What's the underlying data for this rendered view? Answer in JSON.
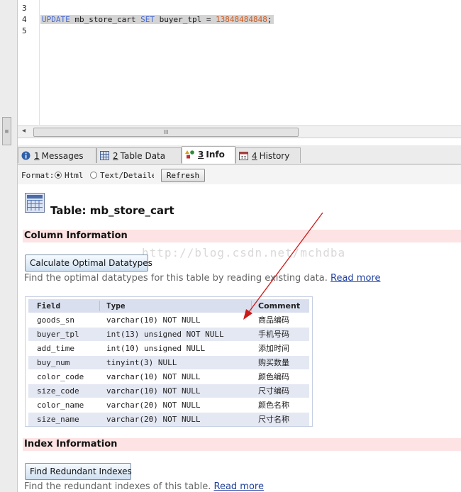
{
  "editor": {
    "line_numbers": [
      "3",
      "4",
      "5"
    ],
    "update_kw": "UPDATE",
    "update_table": " mb_store_cart ",
    "set_kw": "SET",
    "set_expr": " buyer_tpl = ",
    "set_value": "13848484848",
    "terminator": ";",
    "scroll_thumb_grip": "III"
  },
  "tabs": [
    {
      "num": "1",
      "label": "Messages",
      "icon": "info-circle-icon"
    },
    {
      "num": "2",
      "label": "Table Data",
      "icon": "grid-icon"
    },
    {
      "num": "3",
      "label": "Info",
      "icon": "shapes-icon"
    },
    {
      "num": "4",
      "label": "History",
      "icon": "calendar-icon"
    }
  ],
  "active_tab_index": 2,
  "format": {
    "label": "Format:",
    "options": [
      "Html",
      "Text/Detaile"
    ],
    "selected": "Html",
    "refresh_label": "Refresh"
  },
  "info": {
    "table_title": "Table: mb_store_cart",
    "watermark": "http://blog.csdn.net/mchdba",
    "column_section": {
      "title": "Column Information",
      "button_label": "Calculate Optimal Datatypes",
      "description": "Find the optimal datatypes for this table by reading existing data.",
      "link": "Read more"
    },
    "columns_table": {
      "headers": [
        "Field",
        "Type",
        "Comment"
      ],
      "rows": [
        [
          "goods_sn",
          "varchar(10) NOT NULL",
          "商品编码"
        ],
        [
          "buyer_tpl",
          "int(13) unsigned NOT NULL",
          "手机号码"
        ],
        [
          "add_time",
          "int(10) unsigned NULL",
          "添加时间"
        ],
        [
          "buy_num",
          "tinyint(3) NULL",
          "购买数量"
        ],
        [
          "color_code",
          "varchar(10) NOT NULL",
          "颜色编码"
        ],
        [
          "size_code",
          "varchar(10) NOT NULL",
          "尺寸编码"
        ],
        [
          "color_name",
          "varchar(20) NOT NULL",
          "颜色名称"
        ],
        [
          "size_name",
          "varchar(20) NOT NULL",
          "尺寸名称"
        ]
      ]
    },
    "index_section": {
      "title": "Index Information",
      "button_label": "Find Redundant Indexes",
      "description": "Find the redundant indexes of this table.",
      "link": "Read more"
    }
  },
  "colors": {
    "section_header_bg": "#fde3e3",
    "table_odd_row": "#e4e8f3",
    "arrow": "#cc1a1a",
    "link": "#1f3f9f",
    "sql_keyword": "#4a6cd6",
    "sql_number": "#d05a1e"
  }
}
